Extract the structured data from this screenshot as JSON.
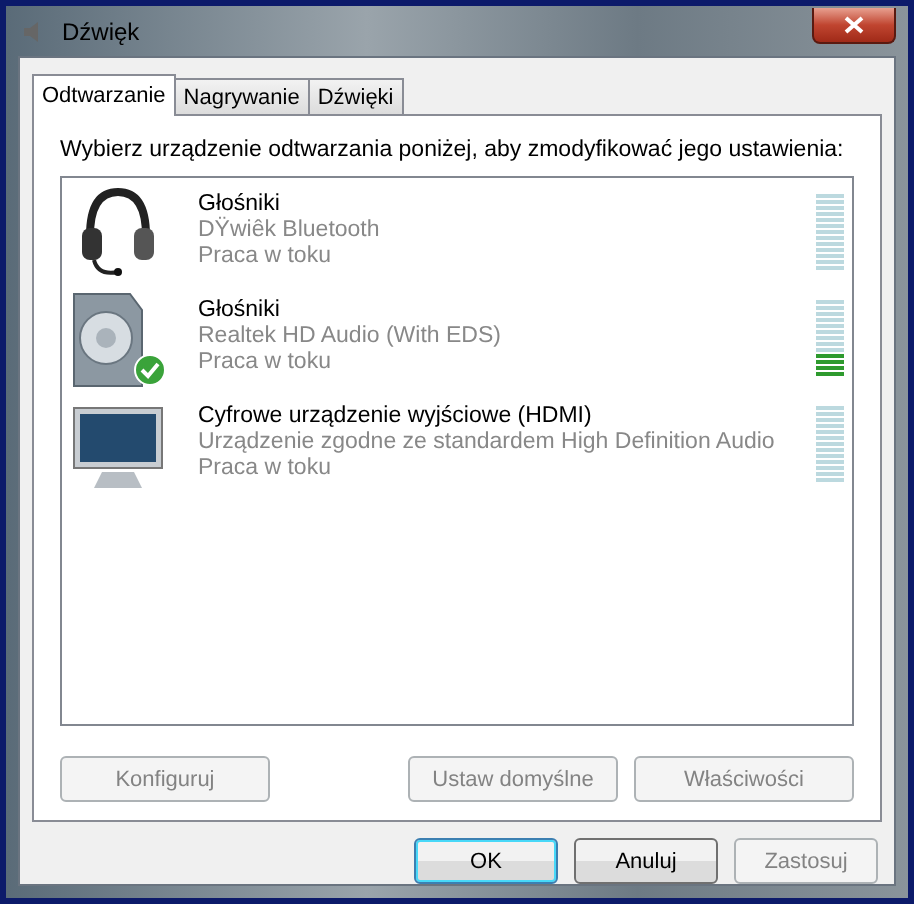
{
  "window": {
    "title": "Dźwięk"
  },
  "tabs": [
    {
      "label": "Odtwarzanie",
      "selected": true
    },
    {
      "label": "Nagrywanie",
      "selected": false
    },
    {
      "label": "Dźwięki",
      "selected": false
    }
  ],
  "instruction": "Wybierz urządzenie odtwarzania poniżej, aby zmodyfikować jego ustawienia:",
  "devices": [
    {
      "kind": "headset",
      "name": "Głośniki",
      "driver": "DŸwiêk Bluetooth",
      "status": "Praca w toku",
      "default": false,
      "level": 0
    },
    {
      "kind": "speaker",
      "name": "Głośniki",
      "driver": "Realtek HD Audio (With EDS)",
      "status": "Praca w toku",
      "default": true,
      "level": 0.34
    },
    {
      "kind": "monitor",
      "name": "Cyfrowe urządzenie wyjściowe (HDMI)",
      "driver": "Urządzenie zgodne ze standardem High Definition Audio",
      "status": "Praca w toku",
      "default": false,
      "level": 0
    }
  ],
  "panel_buttons": [
    {
      "label": "Konfiguruj",
      "disabled": true
    },
    {
      "label": "Ustaw domyślne",
      "disabled": true
    },
    {
      "label": "Właściwości",
      "disabled": true
    }
  ],
  "dialog_buttons": [
    {
      "label": "OK",
      "disabled": false,
      "default": true
    },
    {
      "label": "Anuluj",
      "disabled": false,
      "default": false
    },
    {
      "label": "Zastosuj",
      "disabled": true,
      "default": false
    }
  ]
}
